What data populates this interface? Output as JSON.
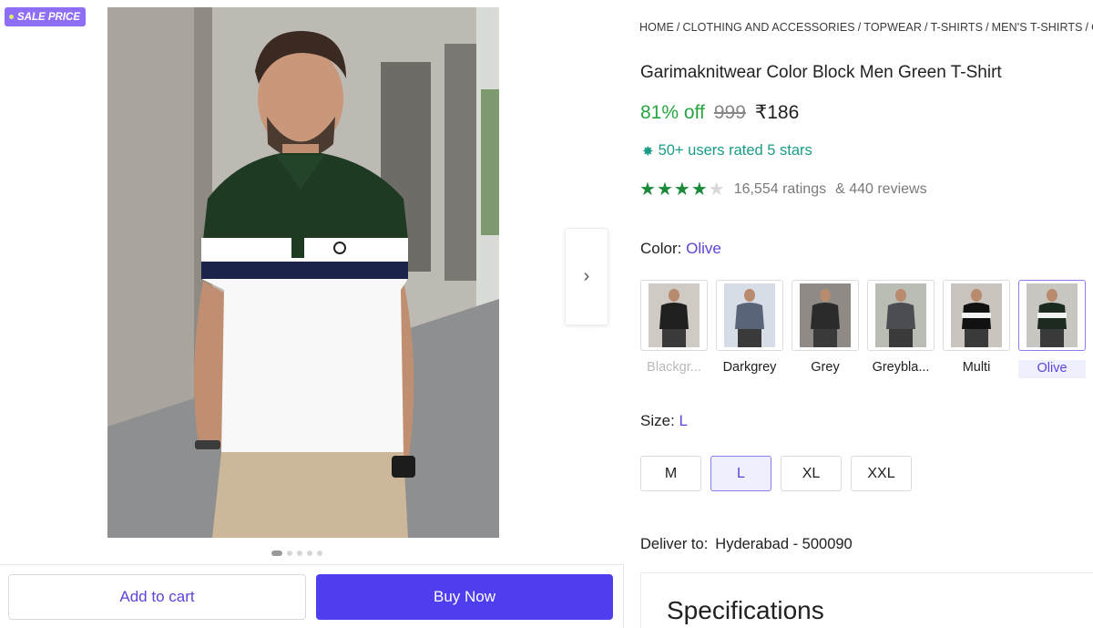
{
  "badge": {
    "sale_label": "SALE PRICE"
  },
  "gallery": {
    "image_count": 5,
    "active_index": 0,
    "next_arrow": "›",
    "icon": "chevron-right-icon"
  },
  "actions": {
    "add_to_cart": "Add to cart",
    "buy_now": "Buy Now"
  },
  "breadcrumb": [
    "HOME",
    "CLOTHING AND ACCESSORIES",
    "TOPWEAR",
    "T-SHIRTS",
    "MEN'S T-SHIRTS",
    "GA"
  ],
  "product": {
    "title": "Garimaknitwear Color Block Men Green T-Shirt",
    "discount": "81% off",
    "mrp": "999",
    "price": "₹186",
    "rated_text": "50+ users rated 5 stars",
    "rating_stars": 4,
    "ratings_text": "16,554 ratings",
    "reviews_text": "& 440 reviews"
  },
  "color": {
    "label": "Color:",
    "value": "Olive",
    "options": [
      {
        "label": "Blackgr...",
        "state": "disabled",
        "shirt": "#1f1f1f",
        "bg": "#cfcac4"
      },
      {
        "label": "Darkgrey",
        "state": "normal",
        "shirt": "#5a6478",
        "bg": "#d7dde6"
      },
      {
        "label": "Grey",
        "state": "normal",
        "shirt": "#2b2b2b",
        "bg": "#8f8a85"
      },
      {
        "label": "Greybla...",
        "state": "normal",
        "shirt": "#4a4d52",
        "bg": "#b9bdb3"
      },
      {
        "label": "Multi",
        "state": "normal",
        "shirt": "#111111",
        "bg": "#c9c4bd"
      },
      {
        "label": "Olive",
        "state": "selected",
        "shirt": "#1d2a1f",
        "bg": "#c8c6c0"
      }
    ]
  },
  "size": {
    "label": "Size:",
    "value": "L",
    "options": [
      "M",
      "L",
      "XL",
      "XXL"
    ],
    "selected": "L"
  },
  "delivery": {
    "label": "Deliver to:",
    "location": "Hyderabad - 500090"
  },
  "specifications": {
    "title": "Specifications"
  },
  "colors": {
    "accent": "#4f3df0",
    "discount_green": "#26a541",
    "rating_teal": "#1a9c86",
    "star_green": "#1b8a3a",
    "badge_purple": "#8e6ef5"
  }
}
